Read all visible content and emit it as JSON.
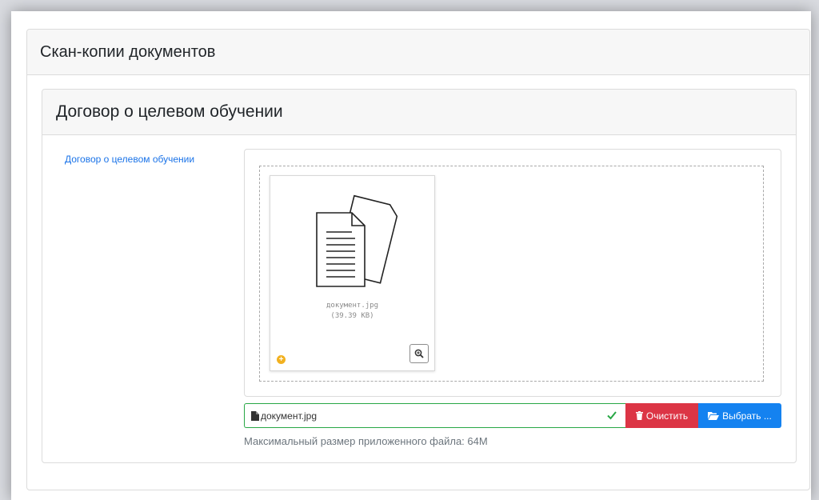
{
  "section": {
    "title": "Скан-копии документов"
  },
  "subsection": {
    "title": "Договор о целевом обучении",
    "field_label": "Договор о целевом обучении"
  },
  "preview": {
    "file_name": "документ.jpg",
    "file_size": "(39.39 KB)",
    "add_icon": "plus-circle-icon",
    "zoom_icon": "zoom-in-icon"
  },
  "file_input": {
    "value": "документ.jpg",
    "status_icon": "check-icon"
  },
  "buttons": {
    "clear_label": "Очистить",
    "choose_label": "Выбрать ..."
  },
  "hint": "Максимальный размер приложенного файла: 64M",
  "colors": {
    "success": "#28a745",
    "danger": "#dc3545",
    "primary": "#1482f0",
    "link": "#1a73e8",
    "warning": "#f2b120"
  }
}
